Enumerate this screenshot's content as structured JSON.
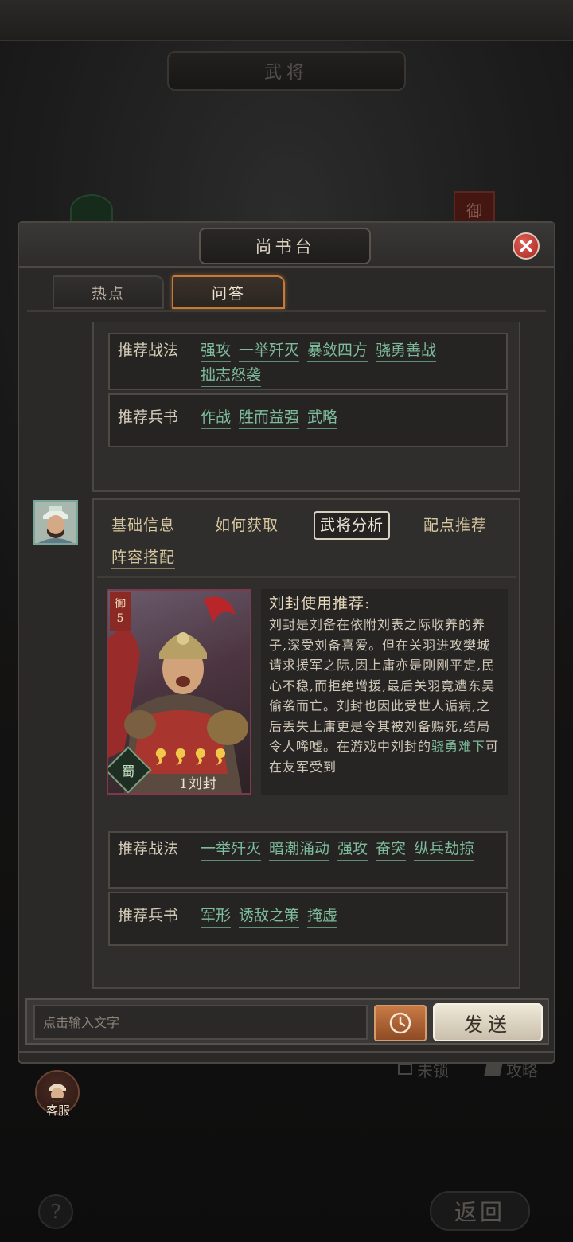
{
  "background": {
    "screen_title": "武将",
    "faction_badge": "御",
    "lock_label": "未锁",
    "guide_label": "攻略",
    "help_label": "?",
    "back_label": "返回",
    "service_label": "客服"
  },
  "dialog": {
    "title": "尚书台",
    "tabs": [
      {
        "label": "热点",
        "active": false
      },
      {
        "label": "问答",
        "active": true
      }
    ]
  },
  "previous_answer": {
    "tactics_label": "推荐战法",
    "tactics": [
      "强攻",
      "一举歼灭",
      "暴敛四方",
      "骁勇善战",
      "拙志怒袭"
    ],
    "books_label": "推荐兵书",
    "books": [
      "作战",
      "胜而益强",
      "武略"
    ]
  },
  "answer": {
    "nav": [
      {
        "label": "基础信息",
        "active": false
      },
      {
        "label": "如何获取",
        "active": false
      },
      {
        "label": "武将分析",
        "active": true
      },
      {
        "label": "配点推荐",
        "active": false
      },
      {
        "label": "阵容搭配",
        "active": false
      }
    ],
    "card": {
      "faction_mark": "御",
      "cost": "5",
      "kingdom": "蜀",
      "stars": 4,
      "name": "1刘封"
    },
    "analysis_title": "刘封使用推荐:",
    "analysis_text": "刘封是刘备在依附刘表之际收养的养子,深受刘备喜爱。但在关羽进攻樊城请求援军之际,因上庸亦是刚刚平定,民心不稳,而拒绝增援,最后关羽竟遭东吴偷袭而亡。刘封也因此受世人诟病,之后丢失上庸更是令其被刘备赐死,结局令人唏嘘。在游戏中刘封的",
    "analysis_highlight": "骁勇难下",
    "analysis_tail": "可在友军受到",
    "tactics_label": "推荐战法",
    "tactics": [
      "一举歼灭",
      "暗潮涌动",
      "强攻",
      "奋突",
      "纵兵劫掠"
    ],
    "books_label": "推荐兵书",
    "books": [
      "军形",
      "诱敌之策",
      "掩虚"
    ]
  },
  "input": {
    "placeholder": "点击输入文字",
    "value": "",
    "send_label": "发送"
  },
  "colors": {
    "link_green": "#7dbb9a",
    "accent_orange": "#c47a3a",
    "close_red": "#c23a33"
  }
}
